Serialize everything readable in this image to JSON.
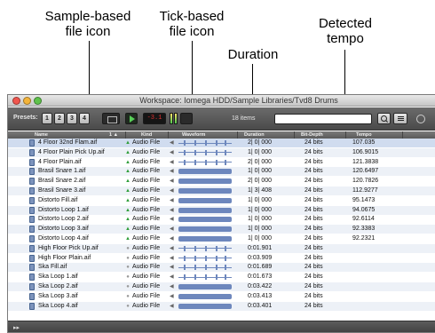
{
  "callouts": {
    "sample_based": "Sample-based\nfile icon",
    "tick_based": "Tick-based\nfile icon",
    "duration": "Duration",
    "detected_tempo": "Detected\ntempo"
  },
  "window": {
    "title": "Workspace: Iomega HDD/Sample Libraries/Tvd8 Drums"
  },
  "toolbar": {
    "presets_label": "Presets:",
    "presets": [
      "1",
      "2",
      "3",
      "4"
    ],
    "volume_display": "-3.1",
    "items_count": "18 items",
    "search_value": ""
  },
  "columns": {
    "name": "Name",
    "number": "1 ▲",
    "kind": "Kind",
    "waveform": "Waveform",
    "duration": "Duration",
    "bit_depth": "Bit-Depth",
    "tempo": "Tempo"
  },
  "files": [
    {
      "name": "4 Floor 32nd Flam.aif",
      "kind": "Audio File",
      "timebase": "ticks",
      "duration": "2| 0| 000",
      "bit_depth": "24 bits",
      "tempo": "107.035",
      "waveform": "sparse",
      "selected": true
    },
    {
      "name": "4 Floor Plain Pick Up.aif",
      "kind": "Audio File",
      "timebase": "ticks",
      "duration": "1| 0| 000",
      "bit_depth": "24 bits",
      "tempo": "106.9015",
      "waveform": "sparse",
      "selected": false
    },
    {
      "name": "4 Floor Plain.aif",
      "kind": "Audio File",
      "timebase": "ticks",
      "duration": "2| 0| 000",
      "bit_depth": "24 bits",
      "tempo": "121.3838",
      "waveform": "sparse",
      "selected": false
    },
    {
      "name": "Brasil Snare 1.aif",
      "kind": "Audio File",
      "timebase": "ticks",
      "duration": "1| 0| 000",
      "bit_depth": "24 bits",
      "tempo": "120.6497",
      "waveform": "dense",
      "selected": false
    },
    {
      "name": "Brasil Snare 2.aif",
      "kind": "Audio File",
      "timebase": "ticks",
      "duration": "2| 0| 000",
      "bit_depth": "24 bits",
      "tempo": "120.7826",
      "waveform": "dense",
      "selected": false
    },
    {
      "name": "Brasil Snare 3.aif",
      "kind": "Audio File",
      "timebase": "ticks",
      "duration": "1| 3| 408",
      "bit_depth": "24 bits",
      "tempo": "112.9277",
      "waveform": "dense",
      "selected": false
    },
    {
      "name": "Distorto Fill.aif",
      "kind": "Audio File",
      "timebase": "ticks",
      "duration": "1| 0| 000",
      "bit_depth": "24 bits",
      "tempo": "95.1473",
      "waveform": "dense",
      "selected": false
    },
    {
      "name": "Distorto Loop 1.aif",
      "kind": "Audio File",
      "timebase": "ticks",
      "duration": "1| 0| 000",
      "bit_depth": "24 bits",
      "tempo": "94.0675",
      "waveform": "dense",
      "selected": false
    },
    {
      "name": "Distorto Loop 2.aif",
      "kind": "Audio File",
      "timebase": "ticks",
      "duration": "1| 0| 000",
      "bit_depth": "24 bits",
      "tempo": "92.6114",
      "waveform": "dense",
      "selected": false
    },
    {
      "name": "Distorto Loop 3.aif",
      "kind": "Audio File",
      "timebase": "ticks",
      "duration": "1| 0| 000",
      "bit_depth": "24 bits",
      "tempo": "92.3383",
      "waveform": "dense",
      "selected": false
    },
    {
      "name": "Distorto Loop 4.aif",
      "kind": "Audio File",
      "timebase": "ticks",
      "duration": "1| 0| 000",
      "bit_depth": "24 bits",
      "tempo": "92.2321",
      "waveform": "dense",
      "selected": false
    },
    {
      "name": "High Floor Pick Up.aif",
      "kind": "Audio File",
      "timebase": "samples",
      "duration": "0:01.901",
      "bit_depth": "24 bits",
      "tempo": "",
      "waveform": "sparse",
      "selected": false
    },
    {
      "name": "High Floor Plain.aif",
      "kind": "Audio File",
      "timebase": "samples",
      "duration": "0:03.909",
      "bit_depth": "24 bits",
      "tempo": "",
      "waveform": "sparse",
      "selected": false
    },
    {
      "name": "Ska Fill.aif",
      "kind": "Audio File",
      "timebase": "samples",
      "duration": "0:01.689",
      "bit_depth": "24 bits",
      "tempo": "",
      "waveform": "sparse",
      "selected": false
    },
    {
      "name": "Ska Loop 1.aif",
      "kind": "Audio File",
      "timebase": "samples",
      "duration": "0:01.673",
      "bit_depth": "24 bits",
      "tempo": "",
      "waveform": "sparse",
      "selected": false
    },
    {
      "name": "Ska Loop 2.aif",
      "kind": "Audio File",
      "timebase": "samples",
      "duration": "0:03.422",
      "bit_depth": "24 bits",
      "tempo": "",
      "waveform": "dense",
      "selected": false
    },
    {
      "name": "Ska Loop 3.aif",
      "kind": "Audio File",
      "timebase": "samples",
      "duration": "0:03.413",
      "bit_depth": "24 bits",
      "tempo": "",
      "waveform": "dense",
      "selected": false
    },
    {
      "name": "Ska Loop 4.aif",
      "kind": "Audio File",
      "timebase": "samples",
      "duration": "0:03.401",
      "bit_depth": "24 bits",
      "tempo": "",
      "waveform": "dense",
      "selected": false
    }
  ],
  "icons": {
    "tick_based": "green-metronome-triangle",
    "sample_based": "gray-clock-dot"
  },
  "colors": {
    "selection": "#d0dcef",
    "waveform": "#6d87bd",
    "tick_icon": "#2f9e3a"
  }
}
